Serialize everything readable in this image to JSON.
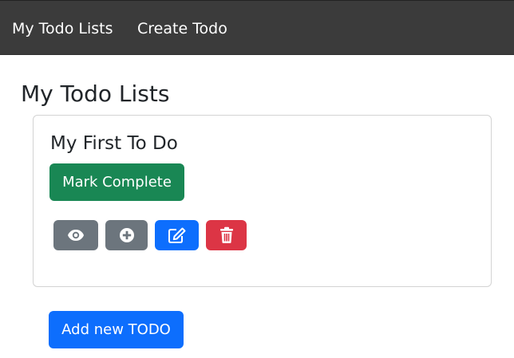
{
  "navbar": {
    "links": [
      {
        "label": "My Todo Lists"
      },
      {
        "label": "Create Todo"
      }
    ]
  },
  "page": {
    "title": "My Todo Lists"
  },
  "todo_card": {
    "title": "My First To Do",
    "complete_label": "Mark Complete",
    "actions": [
      {
        "icon": "eye-icon",
        "color": "#6c757d"
      },
      {
        "icon": "plus-circle-icon",
        "color": "#6c757d"
      },
      {
        "icon": "edit-icon",
        "color": "#0d6efd"
      },
      {
        "icon": "trash-icon",
        "color": "#dc3545"
      }
    ]
  },
  "add_button_label": "Add new TODO",
  "colors": {
    "navbar_bg": "#3b3b3b",
    "success": "#198754",
    "primary": "#0d6efd",
    "secondary": "#6c757d",
    "danger": "#dc3545"
  }
}
